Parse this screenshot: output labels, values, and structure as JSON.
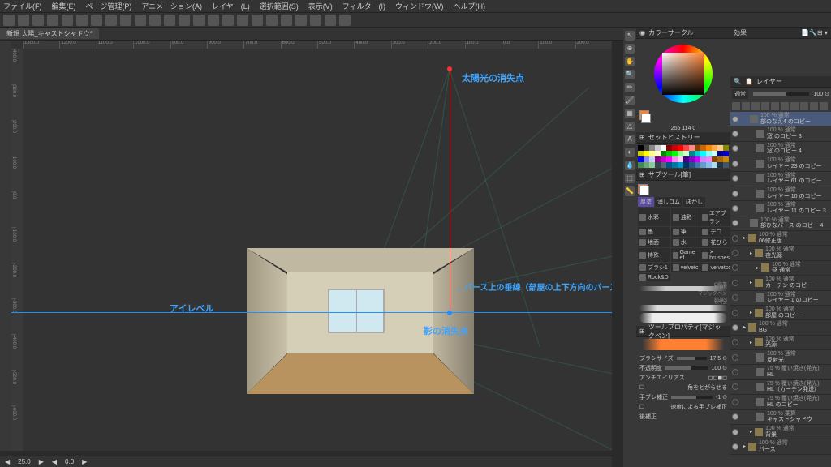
{
  "menu": [
    "ファイル(F)",
    "編集(E)",
    "ページ管理(P)",
    "アニメーション(A)",
    "レイヤー(L)",
    "選択範囲(S)",
    "表示(V)",
    "フィルター(I)",
    "ウィンドウ(W)",
    "ヘルプ(H)"
  ],
  "tab": "新規 太陽_キャストシャドウ*",
  "ruler_marks": [
    "1300.0",
    "1200.0",
    "1100.0",
    "1000.0",
    "900.0",
    "800.0",
    "700.0",
    "600.0",
    "500.0",
    "400.0",
    "300.0",
    "200.0",
    "100.0",
    "0.0",
    "100.0",
    "200.0"
  ],
  "annotations": {
    "sun_vp": "太陽光の消失点",
    "eye_level": "アイレベル",
    "vertical": "←パース上の垂線（部屋の上下方向のパースに沿った線）",
    "shadow_vp": "影の消失点"
  },
  "color_panel": {
    "title": "カラーサークル",
    "rgb": "255  114  0"
  },
  "history_panel": "セットヒストリー",
  "subtool_panel": {
    "title": "サブツール[筆]",
    "tabs": [
      "厚塗",
      "消しゴム",
      "ぼかし"
    ],
    "items": [
      "水彩",
      "油彩",
      "エアブラシ",
      "墨",
      "筆",
      "デコ",
      "地面",
      "水",
      "花びら",
      "特殊",
      "Game ef",
      "✕ brushes",
      "ブラシ1",
      "velvetc",
      "velvetco",
      "Rock&D"
    ]
  },
  "brushes": {
    "pencils": [
      "鉛筆R",
      "C鉛筆",
      "鉛筆S",
      "Yペン",
      "マジックペン"
    ]
  },
  "tool_prop": {
    "title": "ツールプロパティ[マジックペン]",
    "name": "マジックペン",
    "size_label": "ブラシサイズ",
    "size_val": "17.5 ⊙",
    "opacity_label": "不透明度",
    "opacity_val": "100 ⊙",
    "aa_label": "アンチエイリアス",
    "round_label": "角をとがらせる",
    "stab_label": "手ブレ補正",
    "stab_val": "-1 ⊙",
    "speed_label": "速度による手ブレ補正",
    "correct_label": "後補正"
  },
  "layer_panel": {
    "title": "レイヤー",
    "effect_title": "効果",
    "mode": "通常",
    "opacity": "100 ⊙",
    "layers": [
      {
        "op": "100 % 通常",
        "name": "部のなえ4 のコピー",
        "sel": true,
        "eye": true,
        "ind": 1
      },
      {
        "op": "100 % 通常",
        "name": "窓 のコピー 3",
        "eye": true,
        "ind": 2
      },
      {
        "op": "100 % 通常",
        "name": "窓 のコピー 4",
        "eye": true,
        "ind": 2
      },
      {
        "op": "100 % 通常",
        "name": "レイヤー 23 のコピー",
        "eye": true,
        "ind": 2
      },
      {
        "op": "100 % 通常",
        "name": "レイヤー 61 のコピー",
        "eye": true,
        "ind": 2
      },
      {
        "op": "100 % 通常",
        "name": "レイヤー 10 のコピー",
        "eye": true,
        "ind": 2
      },
      {
        "op": "100 % 通常",
        "name": "レイヤー 11 のコピー 3",
        "eye": true,
        "ind": 2
      },
      {
        "op": "100 % 通常",
        "name": "部ひなパース のコピー 4",
        "eye": true,
        "ind": 1
      },
      {
        "op": "100 % 通常",
        "name": "06修正版",
        "eye": false,
        "ind": 0,
        "folder": true
      },
      {
        "op": "100 % 通常",
        "name": "夜光源",
        "eye": false,
        "ind": 1,
        "folder": true
      },
      {
        "op": "100 % 通常",
        "name": "昼 通常",
        "eye": false,
        "ind": 2,
        "folder": true
      },
      {
        "op": "100 % 通常",
        "name": "カーテン のコピー",
        "eye": false,
        "ind": 1,
        "folder": true
      },
      {
        "op": "100 % 通常",
        "name": "レイヤー 1 のコピー",
        "eye": false,
        "ind": 2
      },
      {
        "op": "100 % 通常",
        "name": "部屋 のコピー",
        "eye": false,
        "ind": 1,
        "folder": true
      },
      {
        "op": "100 % 通常",
        "name": "BG",
        "eye": true,
        "ind": 0,
        "folder": true
      },
      {
        "op": "100 % 通常",
        "name": "光源",
        "eye": false,
        "ind": 1,
        "folder": true
      },
      {
        "op": "100 % 通常",
        "name": "反射光",
        "eye": false,
        "ind": 2
      },
      {
        "op": "75 % 覆い焼き(発光)",
        "name": "HL",
        "eye": false,
        "ind": 2
      },
      {
        "op": "75 % 覆い焼き(発光)",
        "name": "HL（カーテン発送）",
        "eye": false,
        "ind": 2
      },
      {
        "op": "75 % 覆い焼き(発光)",
        "name": "HL のコピー",
        "eye": false,
        "ind": 2
      },
      {
        "op": "100 % 乗算",
        "name": "キャストシャドウ",
        "eye": true,
        "ind": 2
      },
      {
        "op": "100 % 通常",
        "name": "背景",
        "eye": true,
        "ind": 1,
        "folder": true
      },
      {
        "op": "100 % 通常",
        "name": "パース",
        "eye": true,
        "ind": 0,
        "folder": true
      }
    ]
  },
  "status": {
    "zoom": "25.0",
    "rot": "0.0"
  },
  "swatch_colors": [
    "#000",
    "#444",
    "#888",
    "#ccc",
    "#fff",
    "#800",
    "#c00",
    "#f00",
    "#f44",
    "#f88",
    "#840",
    "#c60",
    "#f80",
    "#fa4",
    "#fc8",
    "#880",
    "#cc0",
    "#ff0",
    "#ff8",
    "#ffc",
    "#080",
    "#0c0",
    "#0f0",
    "#8f8",
    "#cfc",
    "#088",
    "#0cc",
    "#0ff",
    "#8ff",
    "#cff",
    "#008",
    "#00c",
    "#00f",
    "#88f",
    "#ccf",
    "#808",
    "#c0c",
    "#f0f",
    "#f8f",
    "#fcf",
    "#408",
    "#80c",
    "#c0f",
    "#c8f",
    "#e8f",
    "#840",
    "#a60",
    "#c80",
    "#485",
    "#6a7",
    "#8c9",
    "#345",
    "#567",
    "#058",
    "#07a",
    "#09c",
    "#036",
    "#258",
    "#47a",
    "#69c",
    "#8be",
    "#ade",
    "#234",
    "#456"
  ]
}
